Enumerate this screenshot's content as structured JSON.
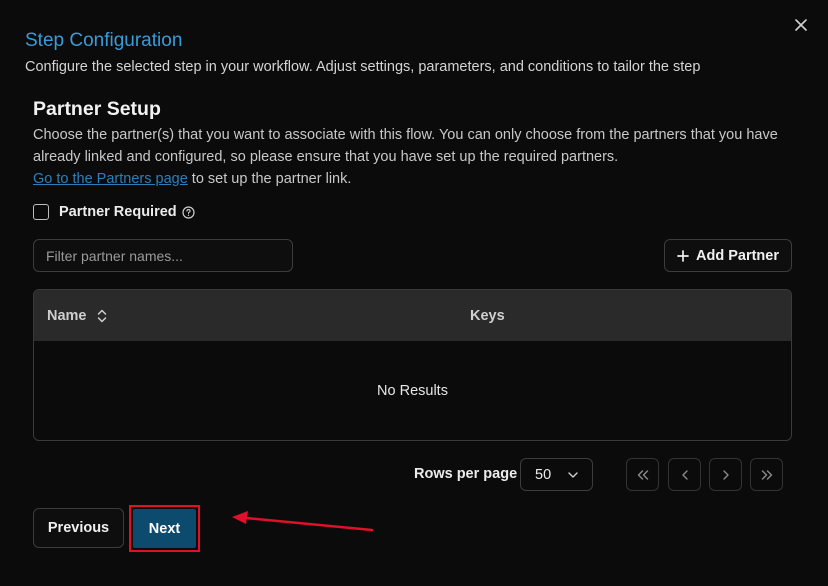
{
  "dialog": {
    "title": "Step Configuration",
    "subtitle": "Configure the selected step in your workflow. Adjust settings, parameters, and conditions to tailor the step"
  },
  "partner_setup": {
    "title": "Partner Setup",
    "description": "Choose the partner(s) that you want to associate with this flow. You can only choose from the partners that you have already linked and configured, so please ensure that you have set up the required partners.",
    "link_text": "Go to the Partners page",
    "link_suffix": " to set up the partner link.",
    "required_label": "Partner Required",
    "required_checked": false
  },
  "filter": {
    "placeholder": "Filter partner names...",
    "value": ""
  },
  "add_partner_label": "Add Partner",
  "table": {
    "columns": [
      "Name",
      "Keys"
    ],
    "empty_text": "No Results"
  },
  "pagination": {
    "rows_label": "Rows per page",
    "rows_value": "50"
  },
  "footer": {
    "previous_label": "Previous",
    "next_label": "Next"
  },
  "colors": {
    "title": "#3a9bd9",
    "next_button": "#0c4a6e",
    "annotation": "#e0102a"
  }
}
